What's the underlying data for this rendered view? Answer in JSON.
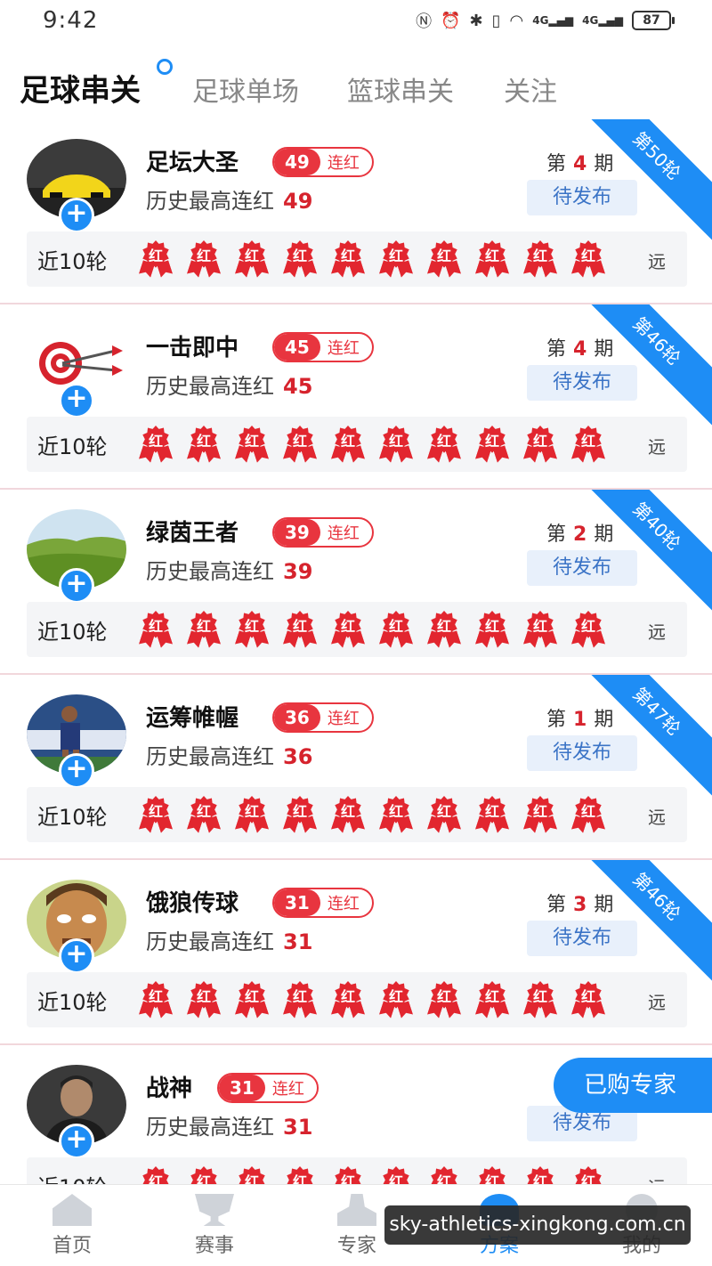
{
  "status_bar": {
    "time": "9:42",
    "battery": "87",
    "signal_1": "4G",
    "signal_2": "4G"
  },
  "tabs": [
    {
      "label": "足球串关",
      "active": true
    },
    {
      "label": "足球单场",
      "active": false
    },
    {
      "label": "篮球串关",
      "active": false
    },
    {
      "label": "关注",
      "active": false
    }
  ],
  "labels": {
    "streak_suffix": "连红",
    "history_prefix": "历史最高连红",
    "recent_label": "近10轮",
    "issue_prefix": "第",
    "issue_suffix": "期",
    "pending": "待发布",
    "far": "远",
    "result_mark": "红"
  },
  "experts": [
    {
      "name": "足坛大圣",
      "streak": "49",
      "history_max": "49",
      "issue": "4",
      "corner": "第50轮",
      "avatar": "avatar-car"
    },
    {
      "name": "一击即中",
      "streak": "45",
      "history_max": "45",
      "issue": "4",
      "corner": "第46轮",
      "avatar": "avatar-target"
    },
    {
      "name": "绿茵王者",
      "streak": "39",
      "history_max": "39",
      "issue": "2",
      "corner": "第40轮",
      "avatar": "avatar-grassland"
    },
    {
      "name": "运筹帷幄",
      "streak": "36",
      "history_max": "36",
      "issue": "1",
      "corner": "第47轮",
      "avatar": "avatar-player"
    },
    {
      "name": "饿狼传球",
      "streak": "31",
      "history_max": "31",
      "issue": "3",
      "corner": "第46轮",
      "avatar": "avatar-cartoon"
    },
    {
      "name": "战神",
      "streak": "31",
      "history_max": "31",
      "issue": "",
      "corner": "",
      "avatar": "avatar-man"
    }
  ],
  "recent_results_count": 10,
  "floating_button": "已购专家",
  "bottom_nav": [
    {
      "label": "首页",
      "icon": "home-icon",
      "active": false
    },
    {
      "label": "赛事",
      "icon": "trophy-icon",
      "active": false
    },
    {
      "label": "专家",
      "icon": "expert-icon",
      "active": false
    },
    {
      "label": "方案",
      "icon": "plan-icon",
      "active": true
    },
    {
      "label": "我的",
      "icon": "profile-icon",
      "active": false
    }
  ],
  "watermark": "sky-athletics-xingkong.com.cn",
  "colors": {
    "accent": "#1e8df5",
    "red": "#e2262f",
    "pending_bg": "#e8f0fb"
  }
}
